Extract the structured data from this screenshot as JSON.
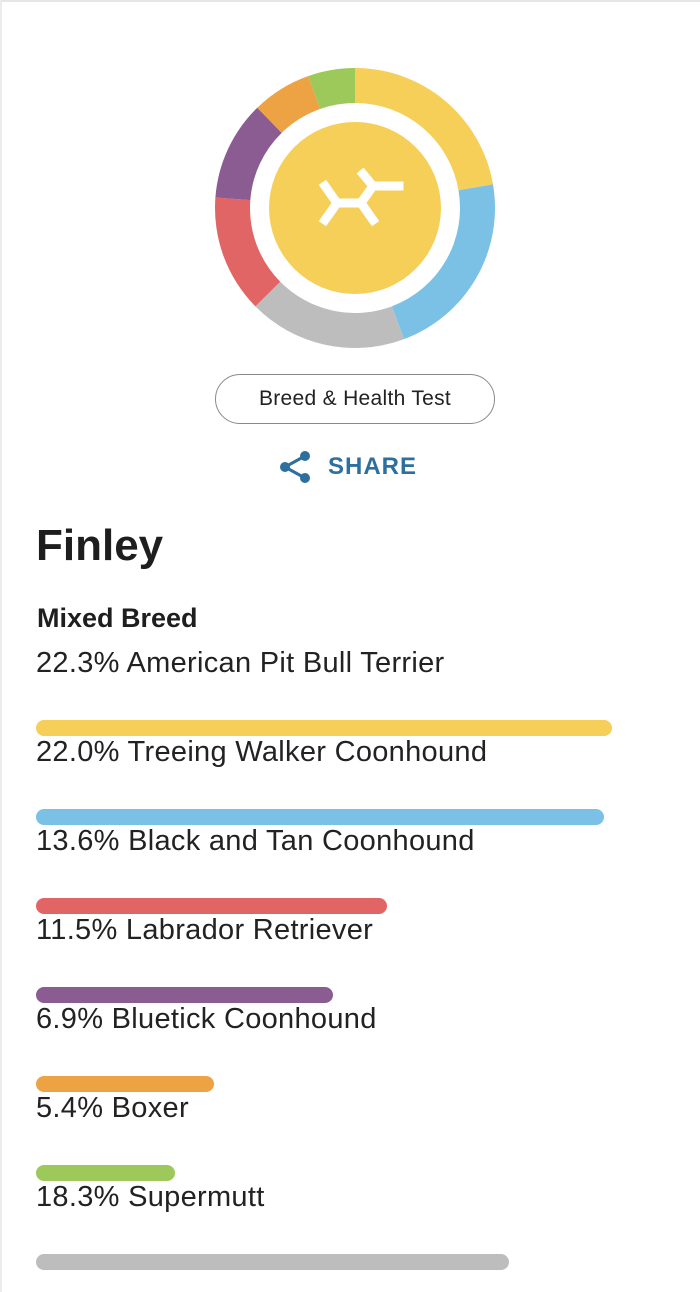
{
  "badge": {
    "label": "Breed & Health Test"
  },
  "share": {
    "label": "SHARE",
    "icon": "share-icon",
    "color": "#2d6f9e"
  },
  "logo": {
    "icon": "embark-logo-icon",
    "color": "#f6cf58"
  },
  "dog": {
    "name": "Finley",
    "breed_type": "Mixed Breed"
  },
  "chart_data": {
    "type": "pie",
    "categories": [
      "American Pit Bull Terrier",
      "Treeing Walker Coonhound",
      "Black and Tan Coonhound",
      "Labrador Retriever",
      "Bluetick Coonhound",
      "Boxer",
      "Supermutt"
    ],
    "values": [
      22.3,
      22.0,
      13.6,
      11.5,
      6.9,
      5.4,
      18.3
    ],
    "colors": [
      "#f6cf58",
      "#7bc1e6",
      "#e26566",
      "#8a5c91",
      "#eda243",
      "#9cc95a",
      "#bdbdbd"
    ],
    "labels": [
      "22.3% American Pit Bull Terrier",
      "22.0% Treeing Walker Coonhound",
      "13.6% Black and Tan Coonhound",
      "11.5% Labrador Retriever",
      "6.9% Bluetick Coonhound",
      "5.4% Boxer",
      "18.3% Supermutt"
    ],
    "donut_order": [
      "American Pit Bull Terrier",
      "Treeing Walker Coonhound",
      "Supermutt",
      "Black and Tan Coonhound",
      "Labrador Retriever",
      "Bluetick Coonhound",
      "Boxer"
    ],
    "bar_max": 22.3
  }
}
